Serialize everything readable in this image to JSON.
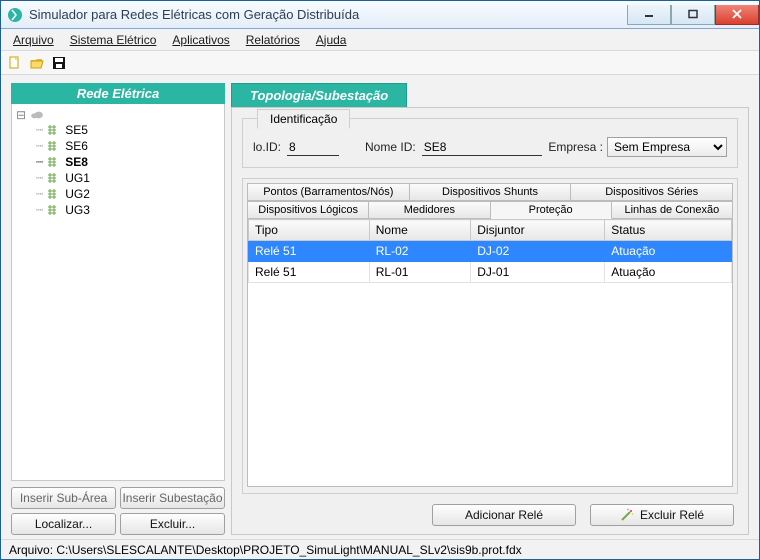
{
  "window": {
    "title": "Simulador para Redes Elétricas com Geração Distribuída"
  },
  "menu": {
    "arquivo": "Arquivo",
    "sistema": "Sistema Elétrico",
    "aplicativos": "Aplicativos",
    "relatorios": "Relatórios",
    "ajuda": "Ajuda"
  },
  "leftpanel": {
    "title": "Rede Elétrica",
    "nodes": [
      "SE5",
      "SE6",
      "SE8",
      "UG1",
      "UG2",
      "UG3"
    ],
    "selected": "SE8",
    "btn_insert_subarea": "Inserir Sub-Área",
    "btn_insert_substation": "Inserir Subestação",
    "btn_locate": "Localizar...",
    "btn_delete": "Excluir..."
  },
  "maintab": {
    "label": "Topologia/Subestação"
  },
  "ident": {
    "tab": "Identificação",
    "noid_label": "lo.ID:",
    "noid_value": "8",
    "nome_label": "Nome ID:",
    "nome_value": "SE8",
    "empresa_label": "Empresa :",
    "empresa_value": "Sem Empresa"
  },
  "subtabs_row1": {
    "t1": "Pontos (Barramentos/Nós)",
    "t2": "Dispositivos Shunts",
    "t3": "Dispositivos Séries"
  },
  "subtabs_row2": {
    "t1": "Dispositivos Lógicos",
    "t2": "Medidores",
    "t3": "Proteção",
    "t4": "Linhas de Conexão"
  },
  "table": {
    "headers": {
      "tipo": "Tipo",
      "nome": "Nome",
      "disjuntor": "Disjuntor",
      "status": "Status"
    },
    "rows": [
      {
        "tipo": "Relé 51",
        "nome": "RL-02",
        "disjuntor": "DJ-02",
        "status": "Atuação",
        "selected": true
      },
      {
        "tipo": "Relé 51",
        "nome": "RL-01",
        "disjuntor": "DJ-01",
        "status": "Atuação",
        "selected": false
      }
    ]
  },
  "rightbtns": {
    "add": "Adicionar Relé",
    "del": "Excluir Relé"
  },
  "status": {
    "path": "Arquivo: C:\\Users\\SLESCALANTE\\Desktop\\PROJETO_SimuLight\\MANUAL_SLv2\\sis9b.prot.fdx"
  }
}
